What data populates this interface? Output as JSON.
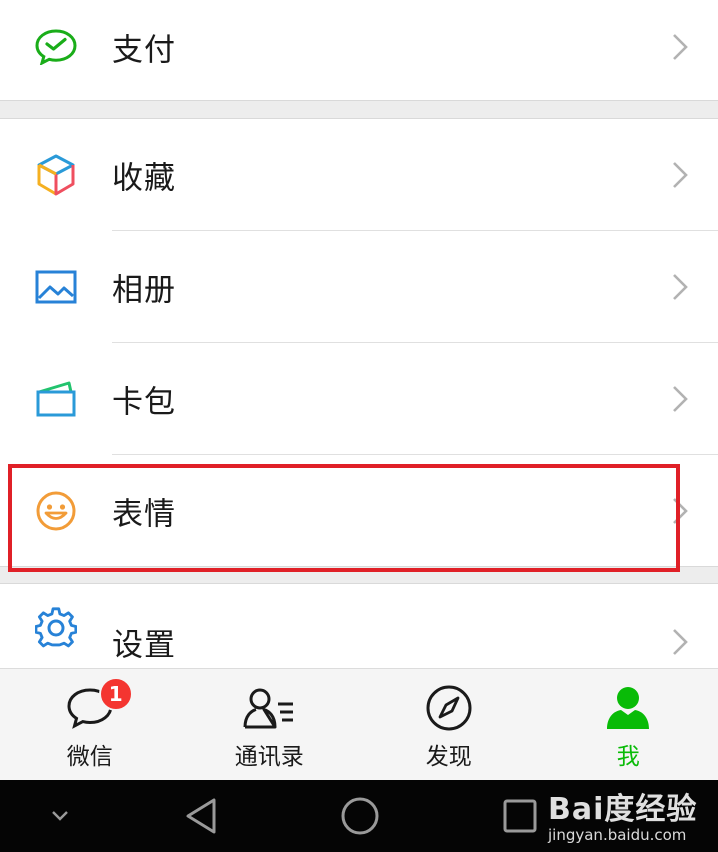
{
  "menu": {
    "pay": "支付",
    "favorites": "收藏",
    "album": "相册",
    "card_wallet": "卡包",
    "stickers": "表情",
    "settings": "设置"
  },
  "tabbar": {
    "chats": "微信",
    "chats_badge": "1",
    "contacts": "通讯录",
    "discover": "发现",
    "me": "我"
  },
  "watermark": {
    "brand": "Bai度经验",
    "url": "jingyan.baidu.com"
  },
  "colors": {
    "accent": "#09bb07",
    "highlight_box": "#e02027",
    "badge": "#f43530",
    "pay_icon": "#1aad19",
    "album_icon": "#2782d7",
    "card_icon": "#2a9ad8",
    "sticker_icon": "#f29c38",
    "settings_icon": "#2782d7"
  },
  "icons": {
    "pay": "wechat-pay-icon",
    "favorites": "cube-icon",
    "album": "image-icon",
    "card_wallet": "card-icon",
    "stickers": "smiley-icon",
    "settings": "gear-icon"
  }
}
